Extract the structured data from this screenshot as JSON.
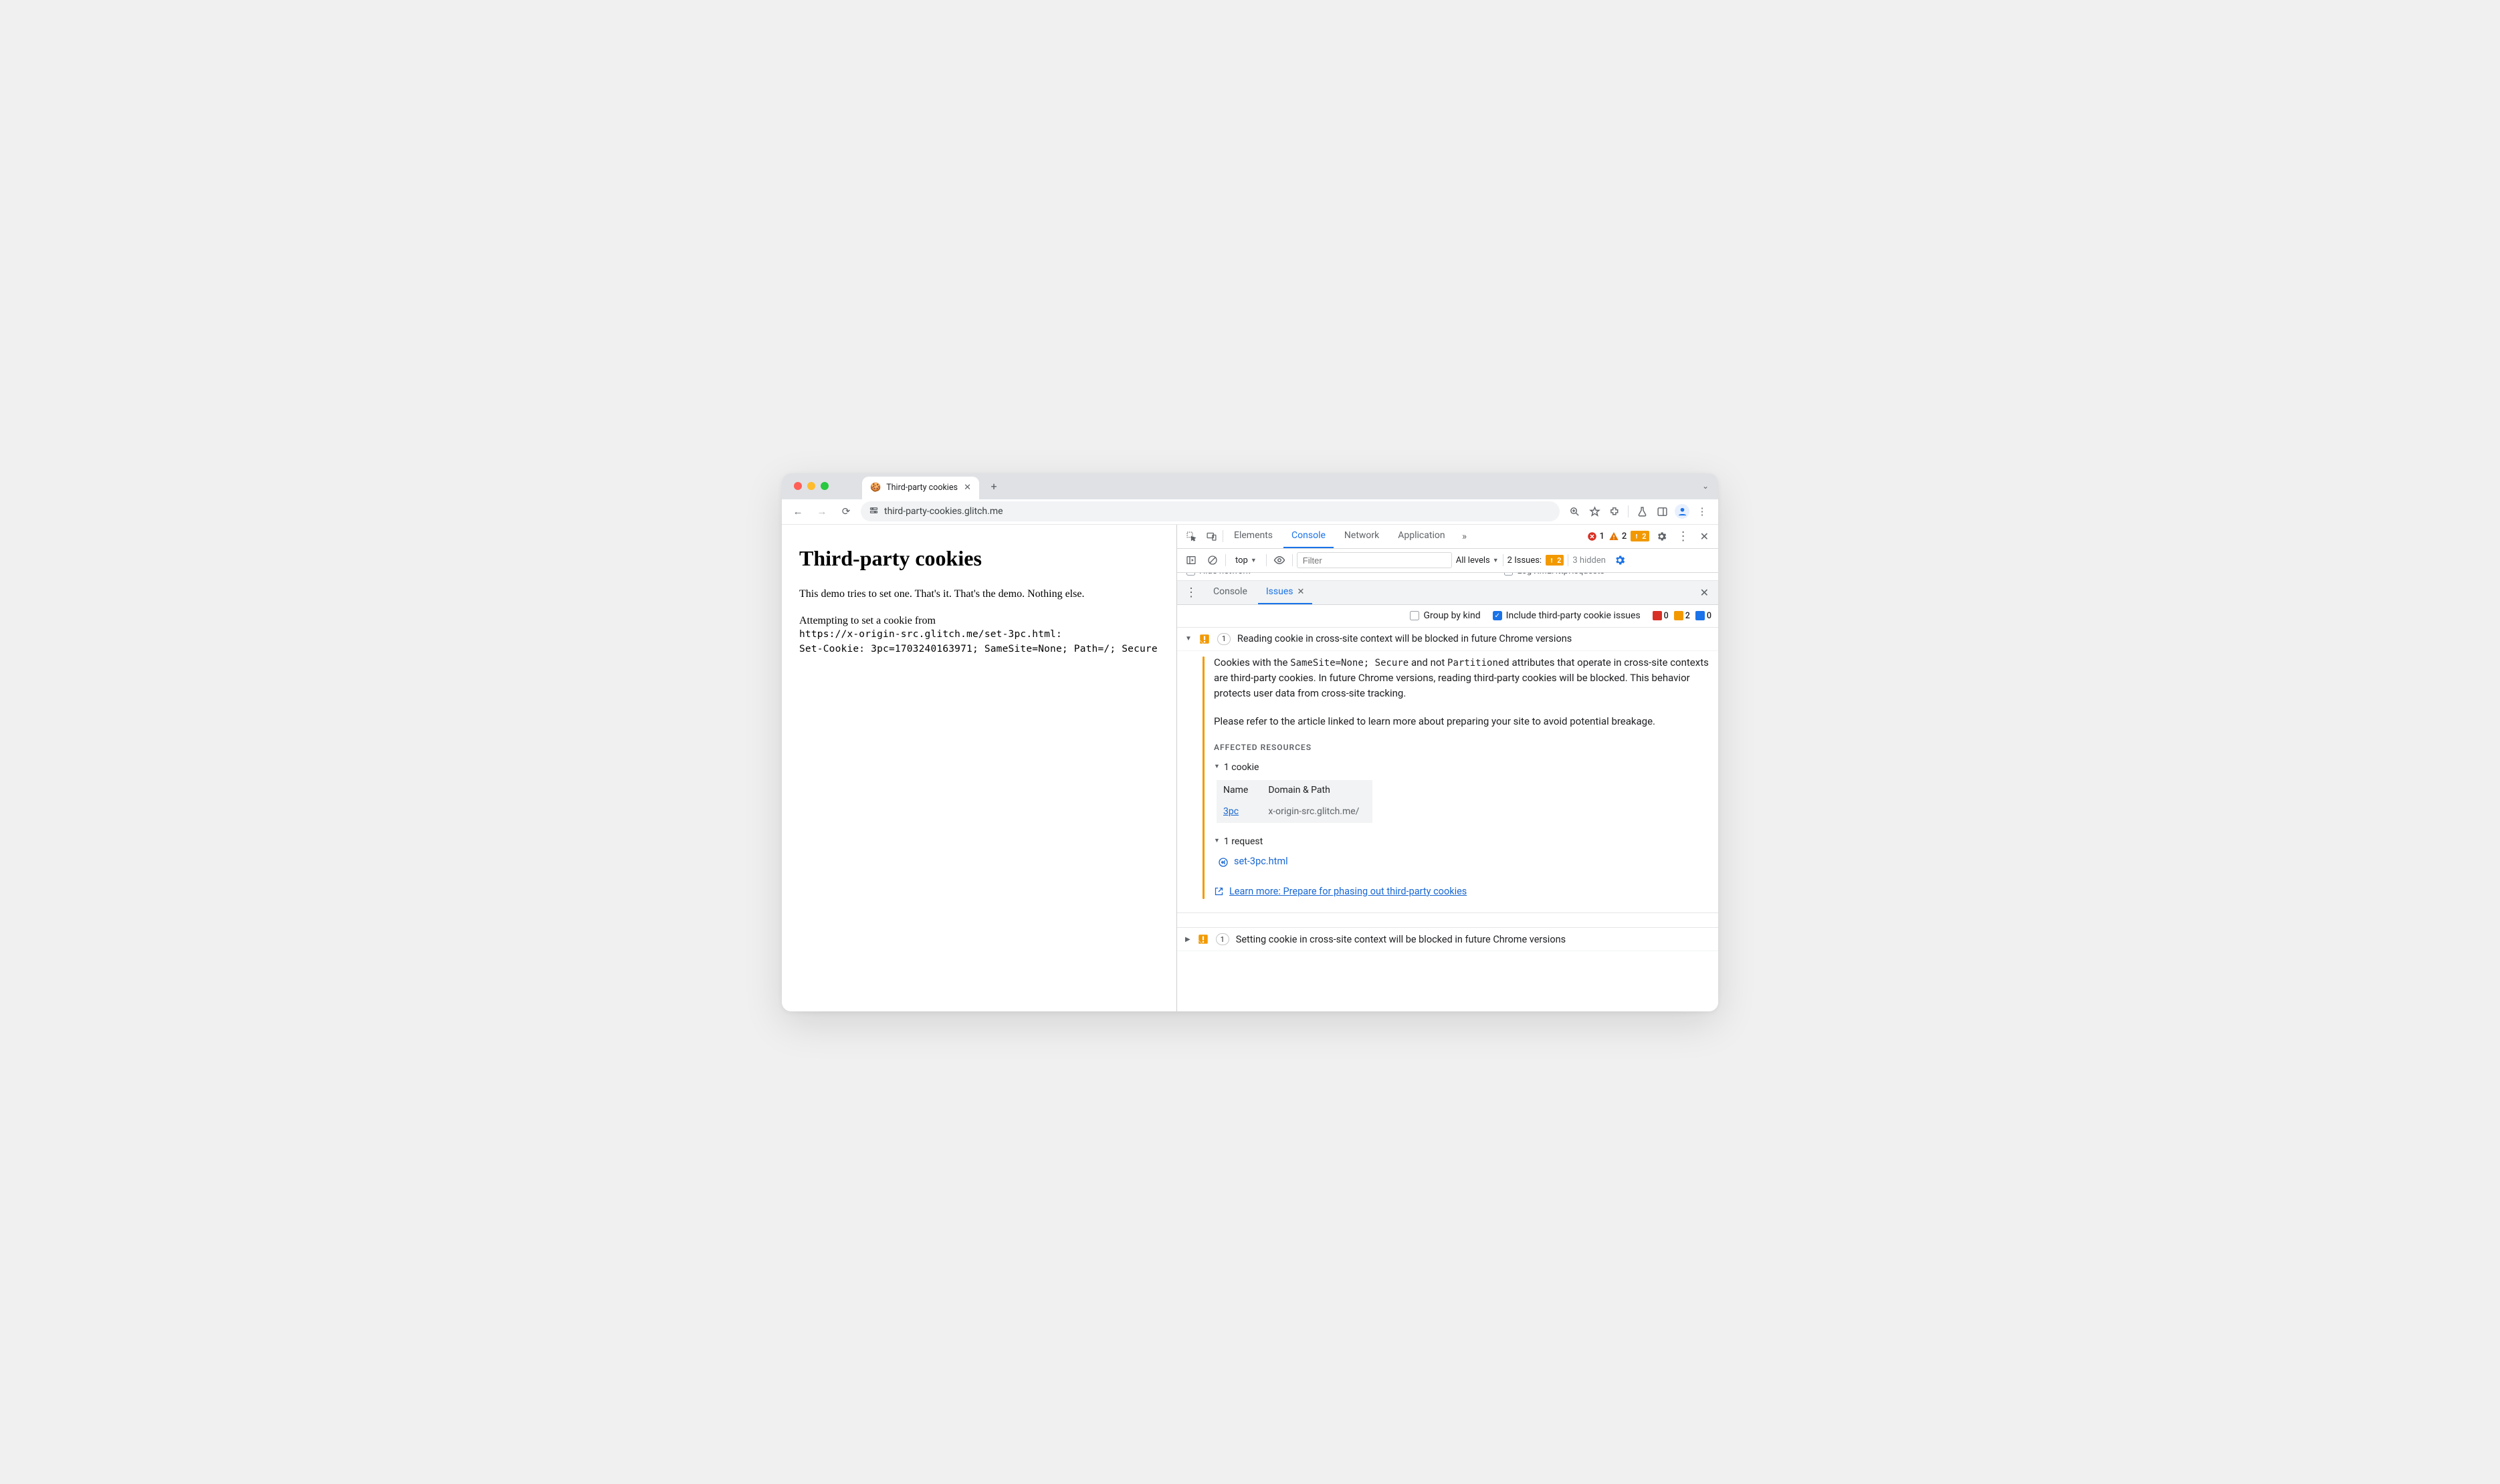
{
  "browser": {
    "tab_title": "Third-party cookies",
    "url": "third-party-cookies.glitch.me"
  },
  "page": {
    "heading": "Third-party cookies",
    "intro": "This demo tries to set one. That's it. That's the demo. Nothing else.",
    "attempt_prefix": "Attempting to set a cookie from",
    "attempt_url": "https://x-origin-src.glitch.me/set-3pc.html:",
    "set_cookie": "Set-Cookie: 3pc=1703240163971; SameSite=None; Path=/; Secure"
  },
  "devtools": {
    "tabs": [
      "Elements",
      "Console",
      "Network",
      "Application"
    ],
    "active_tab": "Console",
    "error_count": "1",
    "warning_count": "2",
    "issues_badge": "2",
    "context": "top",
    "filter_placeholder": "Filter",
    "levels_label": "All levels",
    "issues_label": "2 Issues:",
    "issues_label_badge": "2",
    "hidden_label": "3 hidden",
    "clipped_left": "Hide network",
    "clipped_right": "Log XMLHttpRequests"
  },
  "drawer": {
    "tabs": {
      "console": "Console",
      "issues": "Issues"
    },
    "toolbar": {
      "group_by_kind": "Group by kind",
      "include_third_party": "Include third-party cookie issues",
      "counts": {
        "red": "0",
        "orange": "2",
        "blue": "0"
      }
    }
  },
  "issues": {
    "expanded": {
      "count": "1",
      "title": "Reading cookie in cross-site context will be blocked in future Chrome versions",
      "para1_pre": "Cookies with the ",
      "para1_code1": "SameSite=None; Secure",
      "para1_mid": " and not ",
      "para1_code2": "Partitioned",
      "para1_post": " attributes that operate in cross-site contexts are third-party cookies. In future Chrome versions, reading third-party cookies will be blocked. This behavior protects user data from cross-site tracking.",
      "para2": "Please refer to the article linked to learn more about preparing your site to avoid potential breakage.",
      "affected_heading": "AFFECTED RESOURCES",
      "cookie_toggle": "1 cookie",
      "cookie_headers": {
        "name": "Name",
        "domain": "Domain & Path"
      },
      "cookie_row": {
        "name": "3pc",
        "domain": "x-origin-src.glitch.me/"
      },
      "request_toggle": "1 request",
      "request_name": "set-3pc.html",
      "learn_more": "Learn more: Prepare for phasing out third-party cookies"
    },
    "collapsed": {
      "count": "1",
      "title": "Setting cookie in cross-site context will be blocked in future Chrome versions"
    }
  }
}
